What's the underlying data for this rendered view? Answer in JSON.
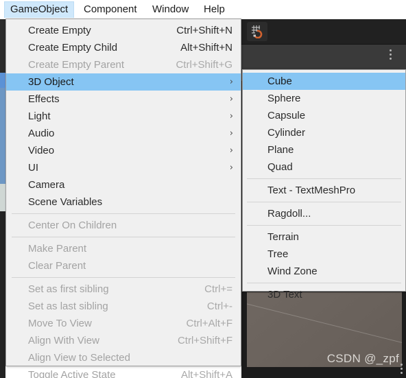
{
  "menubar": {
    "items": [
      {
        "label": "GameObject",
        "active": true
      },
      {
        "label": "Component",
        "active": false
      },
      {
        "label": "Window",
        "active": false
      },
      {
        "label": "Help",
        "active": false
      }
    ]
  },
  "gameobject_menu": {
    "items": [
      {
        "label": "Create Empty",
        "shortcut": "Ctrl+Shift+N",
        "submenu": false,
        "disabled": false,
        "selected": false
      },
      {
        "label": "Create Empty Child",
        "shortcut": "Alt+Shift+N",
        "submenu": false,
        "disabled": false,
        "selected": false
      },
      {
        "label": "Create Empty Parent",
        "shortcut": "Ctrl+Shift+G",
        "submenu": false,
        "disabled": true,
        "selected": false
      },
      {
        "label": "3D Object",
        "shortcut": "",
        "submenu": true,
        "disabled": false,
        "selected": true
      },
      {
        "label": "Effects",
        "shortcut": "",
        "submenu": true,
        "disabled": false,
        "selected": false
      },
      {
        "label": "Light",
        "shortcut": "",
        "submenu": true,
        "disabled": false,
        "selected": false
      },
      {
        "label": "Audio",
        "shortcut": "",
        "submenu": true,
        "disabled": false,
        "selected": false
      },
      {
        "label": "Video",
        "shortcut": "",
        "submenu": true,
        "disabled": false,
        "selected": false
      },
      {
        "label": "UI",
        "shortcut": "",
        "submenu": true,
        "disabled": false,
        "selected": false
      },
      {
        "label": "Camera",
        "shortcut": "",
        "submenu": false,
        "disabled": false,
        "selected": false
      },
      {
        "label": "Scene Variables",
        "shortcut": "",
        "submenu": false,
        "disabled": false,
        "selected": false
      },
      {
        "separator": true
      },
      {
        "label": "Center On Children",
        "shortcut": "",
        "submenu": false,
        "disabled": true,
        "selected": false
      },
      {
        "separator": true
      },
      {
        "label": "Make Parent",
        "shortcut": "",
        "submenu": false,
        "disabled": true,
        "selected": false
      },
      {
        "label": "Clear Parent",
        "shortcut": "",
        "submenu": false,
        "disabled": true,
        "selected": false
      },
      {
        "separator": true
      },
      {
        "label": "Set as first sibling",
        "shortcut": "Ctrl+=",
        "submenu": false,
        "disabled": true,
        "selected": false
      },
      {
        "label": "Set as last sibling",
        "shortcut": "Ctrl+-",
        "submenu": false,
        "disabled": true,
        "selected": false
      },
      {
        "label": "Move To View",
        "shortcut": "Ctrl+Alt+F",
        "submenu": false,
        "disabled": true,
        "selected": false
      },
      {
        "label": "Align With View",
        "shortcut": "Ctrl+Shift+F",
        "submenu": false,
        "disabled": true,
        "selected": false
      },
      {
        "label": "Align View to Selected",
        "shortcut": "",
        "submenu": false,
        "disabled": true,
        "selected": false
      },
      {
        "label": "Toggle Active State",
        "shortcut": "Alt+Shift+A",
        "submenu": false,
        "disabled": true,
        "selected": false
      }
    ]
  },
  "object3d_submenu": {
    "items": [
      {
        "label": "Cube",
        "selected": true
      },
      {
        "label": "Sphere",
        "selected": false
      },
      {
        "label": "Capsule",
        "selected": false
      },
      {
        "label": "Cylinder",
        "selected": false
      },
      {
        "label": "Plane",
        "selected": false
      },
      {
        "label": "Quad",
        "selected": false
      },
      {
        "separator": true
      },
      {
        "label": "Text - TextMeshPro",
        "selected": false
      },
      {
        "separator": true
      },
      {
        "label": "Ragdoll...",
        "selected": false
      },
      {
        "separator": true
      },
      {
        "label": "Terrain",
        "selected": false
      },
      {
        "label": "Tree",
        "selected": false
      },
      {
        "label": "Wind Zone",
        "selected": false
      },
      {
        "separator": true
      },
      {
        "label": "3D Text",
        "selected": false
      }
    ]
  },
  "editor": {
    "watermark": "CSDN @_zpf",
    "snap_icon": "grid-snap-icon",
    "panel_menu_icon": "kebab-menu-icon"
  },
  "colors": {
    "menu_bg": "#f0f0f0",
    "menu_border": "#9f9f9f",
    "highlight": "#86c5f3",
    "menubar_active": "#cfe8fb",
    "text": "#2b2b2b",
    "text_disabled": "#a3a3a3",
    "editor_dark": "#1c1c1c",
    "scene_gray": "#6f6761"
  }
}
